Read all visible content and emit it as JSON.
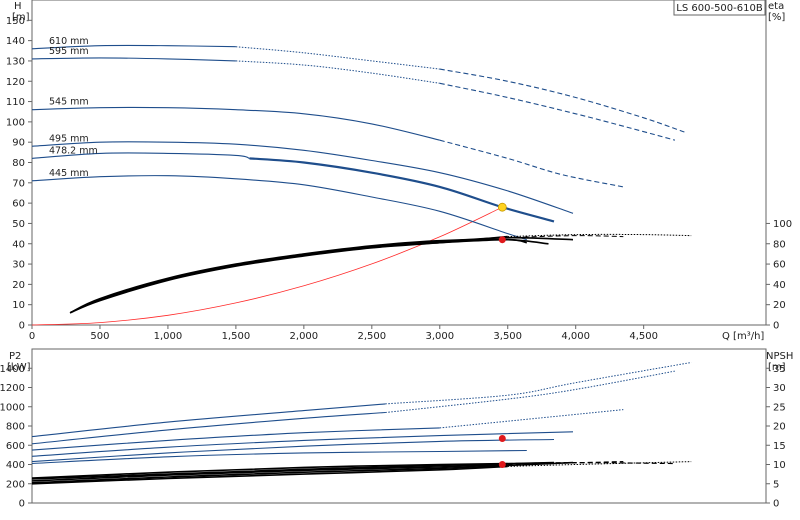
{
  "pump_title": "LS 600-500-610B",
  "colors": {
    "curve": "#1f4e8c",
    "eff": "#000000",
    "system": "#ff2a2a",
    "op_point": "#ffd21f",
    "op_red": "#e0191c"
  },
  "chart_data": [
    {
      "type": "line",
      "title": "",
      "y_left_label": "H",
      "y_left_unit": "[m]",
      "y_right_label": "eta",
      "y_right_unit": "[%]",
      "x_label": "Q [m³/h]",
      "xlim": [
        0,
        5400
      ],
      "ylim": [
        0,
        160
      ],
      "x_ticks": [
        0,
        500,
        1000,
        1500,
        2000,
        2500,
        3000,
        3500,
        4000,
        4500
      ],
      "x_tick_labels": [
        "0",
        "500",
        "1,000",
        "1,500",
        "2,000",
        "2,500",
        "3,000",
        "3,500",
        "4,000",
        "4,500"
      ],
      "y_ticks": [
        0,
        10,
        20,
        30,
        40,
        50,
        60,
        70,
        80,
        90,
        100,
        110,
        120,
        130,
        140,
        150
      ],
      "y_right_ticks": [
        0,
        20,
        40,
        60,
        80,
        100
      ],
      "y_right_scale": "eta% = 0.5 × H",
      "grid": false,
      "series": [
        {
          "name": "610 mm",
          "solid": [
            [
              0,
              136
            ],
            [
              500,
              137.5
            ],
            [
              1000,
              137.5
            ],
            [
              1500,
              137
            ]
          ],
          "dotted": [
            [
              1500,
              137
            ],
            [
              2000,
              134
            ],
            [
              2500,
              130
            ],
            [
              3000,
              126
            ]
          ],
          "dashed": [
            [
              3000,
              126
            ],
            [
              3500,
              120
            ],
            [
              4000,
              112
            ],
            [
              4500,
              102
            ],
            [
              4800,
              95
            ]
          ]
        },
        {
          "name": "595 mm",
          "solid": [
            [
              0,
              131
            ],
            [
              500,
              131.5
            ],
            [
              1000,
              131
            ],
            [
              1500,
              130
            ]
          ],
          "dotted": [
            [
              1500,
              130
            ],
            [
              2000,
              128
            ],
            [
              2500,
              124
            ],
            [
              3000,
              119
            ]
          ],
          "dashed": [
            [
              3000,
              119
            ],
            [
              3500,
              112
            ],
            [
              4000,
              104
            ],
            [
              4400,
              97
            ],
            [
              4730,
              91
            ]
          ]
        },
        {
          "name": "545 mm",
          "solid": [
            [
              0,
              106
            ],
            [
              500,
              107
            ],
            [
              1000,
              107
            ],
            [
              1500,
              106
            ],
            [
              2000,
              104
            ],
            [
              2500,
              99
            ],
            [
              3000,
              91
            ]
          ],
          "dashed": [
            [
              3000,
              91
            ],
            [
              3500,
              82
            ],
            [
              3900,
              74
            ],
            [
              4350,
              68
            ]
          ]
        },
        {
          "name": "495 mm",
          "solid": [
            [
              0,
              88
            ],
            [
              500,
              90
            ],
            [
              1000,
              90
            ],
            [
              1500,
              89
            ],
            [
              2000,
              86
            ],
            [
              2500,
              81
            ],
            [
              3000,
              75
            ],
            [
              3500,
              66
            ],
            [
              3980,
              55
            ]
          ]
        },
        {
          "name": "478.2 mm",
          "solid": [
            [
              0,
              82
            ],
            [
              500,
              84.5
            ],
            [
              1000,
              84.5
            ],
            [
              1500,
              83.5
            ],
            [
              1600,
              82
            ]
          ],
          "bold": [
            [
              1600,
              82
            ],
            [
              2000,
              80
            ],
            [
              2500,
              75
            ],
            [
              3000,
              68
            ],
            [
              3460,
              58
            ],
            [
              3840,
              51
            ]
          ]
        },
        {
          "name": "445 mm",
          "solid": [
            [
              0,
              71
            ],
            [
              500,
              73
            ],
            [
              1000,
              73.5
            ],
            [
              1500,
              72
            ],
            [
              2000,
              69
            ],
            [
              2500,
              63
            ],
            [
              3000,
              56
            ],
            [
              3500,
              45
            ],
            [
              3640,
              42
            ]
          ]
        }
      ],
      "efficiency_curves": [
        {
          "solid": [
            [
              280,
              6
            ],
            [
              500,
              13
            ],
            [
              1000,
              23
            ],
            [
              1500,
              30
            ],
            [
              2000,
              35
            ],
            [
              2500,
              39
            ],
            [
              3000,
              41.5
            ],
            [
              3500,
              42
            ],
            [
              3800,
              40
            ]
          ]
        },
        {
          "solid": [
            [
              280,
              6
            ],
            [
              500,
              12.5
            ],
            [
              1000,
              22.5
            ],
            [
              1500,
              29.5
            ],
            [
              2000,
              34.5
            ],
            [
              2500,
              38.5
            ],
            [
              3000,
              41
            ],
            [
              3500,
              43
            ],
            [
              3980,
              42
            ]
          ],
          "dashed": [
            [
              3500,
              43
            ],
            [
              4000,
              44
            ],
            [
              4350,
              43.5
            ]
          ]
        },
        {
          "solid": [
            [
              280,
              6
            ],
            [
              500,
              12
            ],
            [
              1000,
              22
            ],
            [
              1500,
              29
            ],
            [
              2000,
              34
            ],
            [
              2500,
              38
            ],
            [
              3000,
              40.5
            ],
            [
              3500,
              43.5
            ]
          ],
          "dotted": [
            [
              3500,
              43.5
            ],
            [
              4000,
              44.5
            ],
            [
              4500,
              44.5
            ],
            [
              4850,
              44
            ]
          ]
        },
        {
          "solid": [
            [
              280,
              6
            ],
            [
              500,
              12.2
            ],
            [
              1000,
              22.2
            ],
            [
              1500,
              29.2
            ],
            [
              2000,
              34.2
            ],
            [
              2500,
              38.2
            ],
            [
              3000,
              40.5
            ],
            [
              3500,
              42
            ],
            [
              3640,
              40.5
            ]
          ]
        }
      ],
      "system_curve": [
        [
          0,
          0
        ],
        [
          500,
          1.2
        ],
        [
          1000,
          4.8
        ],
        [
          1500,
          10.9
        ],
        [
          2000,
          19.3
        ],
        [
          2500,
          30.1
        ],
        [
          3000,
          43.4
        ],
        [
          3460,
          58
        ]
      ],
      "operating_points": [
        {
          "x": 3460,
          "y": 58,
          "kind": "duty"
        },
        {
          "x": 3460,
          "y": 42,
          "kind": "eta"
        }
      ]
    },
    {
      "type": "line",
      "title": "",
      "y_left_label": "P2",
      "y_left_unit": "[kW]",
      "y_right_label": "NPSH",
      "y_right_unit": "[m]",
      "xlim": [
        0,
        5400
      ],
      "ylim": [
        0,
        1600
      ],
      "y_ticks": [
        0,
        200,
        400,
        600,
        800,
        1000,
        1200,
        1400
      ],
      "y_right_ticks": [
        0,
        5,
        10,
        15,
        20,
        25,
        30,
        35
      ],
      "y_right_scale": "NPSH = H / 40",
      "grid": false,
      "power_curves": [
        {
          "solid": [
            [
              0,
              690
            ],
            [
              1000,
              840
            ],
            [
              2000,
              960
            ],
            [
              2600,
              1030
            ]
          ],
          "dotted": [
            [
              2600,
              1030
            ],
            [
              3500,
              1120
            ],
            [
              4000,
              1250
            ],
            [
              4850,
              1460
            ]
          ]
        },
        {
          "solid": [
            [
              0,
              615
            ],
            [
              1000,
              760
            ],
            [
              2000,
              880
            ],
            [
              2600,
              940
            ]
          ],
          "dotted": [
            [
              2600,
              940
            ],
            [
              3500,
              1080
            ],
            [
              4000,
              1180
            ],
            [
              4730,
              1370
            ]
          ]
        },
        {
          "solid": [
            [
              0,
              550
            ],
            [
              1000,
              650
            ],
            [
              2000,
              730
            ],
            [
              3000,
              780
            ]
          ],
          "dotted": [
            [
              3000,
              780
            ],
            [
              3500,
              850
            ],
            [
              4350,
              970
            ]
          ]
        },
        {
          "solid": [
            [
              0,
              485
            ],
            [
              1000,
              580
            ],
            [
              2000,
              650
            ],
            [
              3000,
              700
            ],
            [
              3980,
              740
            ]
          ]
        },
        {
          "solid": [
            [
              0,
              430
            ],
            [
              1000,
              520
            ],
            [
              2000,
              590
            ],
            [
              3000,
              640
            ],
            [
              3840,
              660
            ]
          ]
        },
        {
          "solid": [
            [
              0,
              410
            ],
            [
              1000,
              480
            ],
            [
              2000,
              520
            ],
            [
              3000,
              535
            ],
            [
              3640,
              545
            ]
          ]
        }
      ],
      "npsh_curves": [
        {
          "solid": [
            [
              0,
              200
            ],
            [
              1000,
              255
            ],
            [
              2000,
              300
            ],
            [
              3000,
              345
            ],
            [
              3500,
              380
            ]
          ],
          "dotted": [
            [
              3500,
              380
            ],
            [
              4000,
              400
            ],
            [
              4850,
              430
            ]
          ]
        },
        {
          "solid": [
            [
              0,
              210
            ],
            [
              1000,
              270
            ],
            [
              2000,
              320
            ],
            [
              3000,
              360
            ],
            [
              3980,
              420
            ]
          ]
        },
        {
          "solid": [
            [
              0,
              230
            ],
            [
              1000,
              290
            ],
            [
              2000,
              340
            ],
            [
              3000,
              375
            ],
            [
              3500,
              400
            ]
          ],
          "dashed": [
            [
              3500,
              400
            ],
            [
              4350,
              430
            ]
          ]
        },
        {
          "solid": [
            [
              0,
              250
            ],
            [
              1000,
              300
            ],
            [
              2000,
              350
            ],
            [
              3000,
              390
            ],
            [
              3840,
              420
            ]
          ]
        },
        {
          "solid": [
            [
              0,
              260
            ],
            [
              1000,
              320
            ],
            [
              2000,
              370
            ],
            [
              3000,
              400
            ],
            [
              3500,
              410
            ]
          ],
          "dashed": [
            [
              3500,
              410
            ],
            [
              4000,
              420
            ],
            [
              4730,
              410
            ]
          ]
        }
      ],
      "operating_points": [
        {
          "x": 3460,
          "y": 670,
          "kind": "power"
        },
        {
          "x": 3460,
          "y": 400,
          "kind": "npsh"
        }
      ]
    }
  ]
}
